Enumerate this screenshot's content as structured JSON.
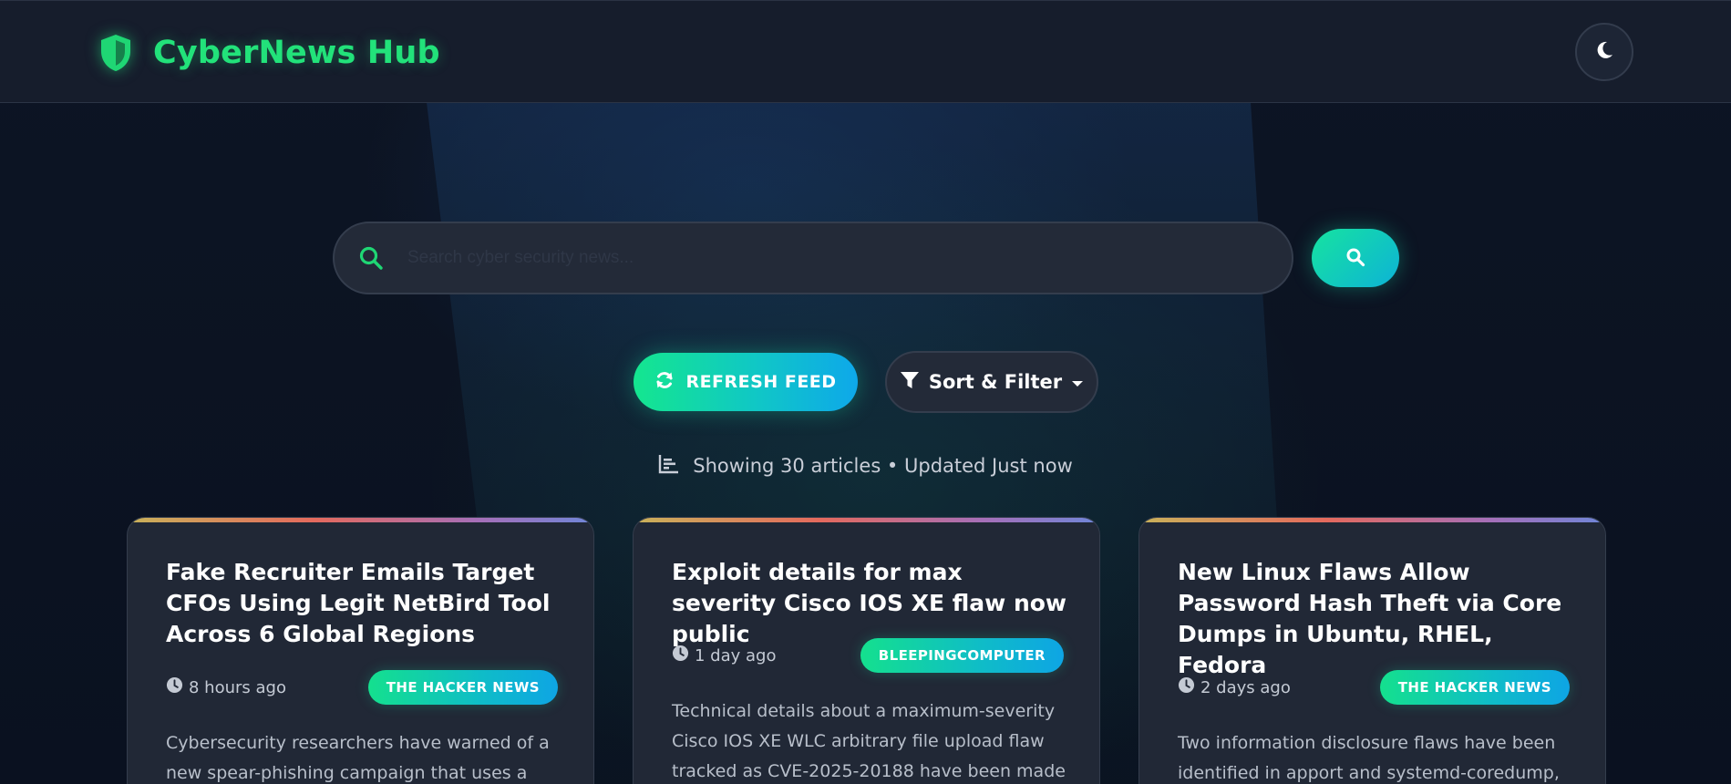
{
  "app": {
    "title": "CyberNews Hub",
    "logo_icon": "shield-icon",
    "theme_icon": "moon-icon"
  },
  "colors": {
    "accent_green": "#22e27a",
    "accent_cyan": "#0ea5e4",
    "background": "#0b1220",
    "card": "#212836"
  },
  "search": {
    "placeholder": "Search cyber security news...",
    "value": "",
    "icon": "search-icon",
    "button_icon": "search-icon"
  },
  "actions": {
    "refresh_label": "REFRESH FEED",
    "refresh_icon": "sync-icon",
    "filter_label": "Sort & Filter",
    "filter_icon": "filter-icon",
    "filter_caret": "caret-down-icon"
  },
  "status": {
    "icon": "bar-chart-icon",
    "text": "Showing 30 articles • Updated Just now"
  },
  "articles": [
    {
      "title": "Fake Recruiter Emails Target CFOs Using Legit NetBird Tool Across 6 Global Regions",
      "time": "8 hours ago",
      "source": "THE HACKER NEWS",
      "summary": "Cybersecurity researchers have warned of a new spear-phishing campaign that uses a legitimate"
    },
    {
      "title": "Exploit details for max severity Cisco IOS XE flaw now public",
      "time": "1 day ago",
      "source": "BLEEPINGCOMPUTER",
      "summary": "Technical details about a maximum-severity Cisco IOS XE WLC arbitrary file upload flaw tracked as CVE-2025-20188 have been made"
    },
    {
      "title": "New Linux Flaws Allow Password Hash Theft via Core Dumps in Ubuntu, RHEL, Fedora",
      "time": "2 days ago",
      "source": "THE HACKER NEWS",
      "summary": "Two information disclosure flaws have been identified in apport and systemd-coredump, the"
    }
  ]
}
